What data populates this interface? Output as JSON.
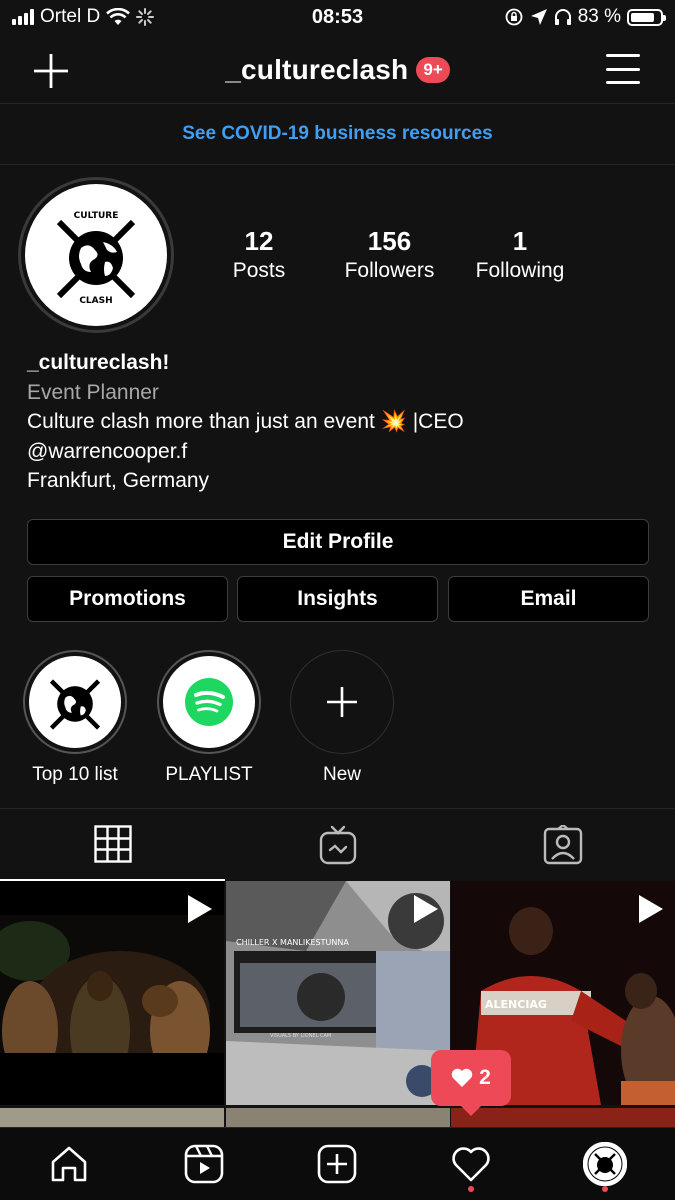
{
  "status": {
    "carrier": "Ortel D",
    "time": "08:53",
    "battery": "83 %"
  },
  "header": {
    "plus_icon": "plus-icon",
    "username": "_cultureclash",
    "badge": "9+",
    "menu_icon": "hamburger-menu-icon"
  },
  "banner": {
    "text": "See COVID-19 business resources"
  },
  "profile": {
    "avatar_text_top": "CULTURE",
    "avatar_text_bottom": "CLASH",
    "stats": [
      {
        "num": "12",
        "label": "Posts"
      },
      {
        "num": "156",
        "label": "Followers"
      },
      {
        "num": "1",
        "label": "Following"
      }
    ],
    "bio": {
      "name": "_cultureclash!",
      "category": "Event Planner",
      "line1": "Culture clash more than just an event",
      "line1_emoji": "💥",
      "line1_tail": " |CEO",
      "line2": "@warrencooper.f",
      "line3": "Frankfurt, Germany"
    }
  },
  "buttons": {
    "edit": "Edit Profile",
    "promotions": "Promotions",
    "insights": "Insights",
    "email": "Email"
  },
  "highlights": [
    {
      "label": "Top 10 list",
      "icon": "culture-clash-logo"
    },
    {
      "label": "PLAYLIST",
      "icon": "spotify-icon"
    },
    {
      "label": "New",
      "icon": "plus-icon"
    }
  ],
  "tabs": [
    {
      "icon": "grid-icon",
      "active": true
    },
    {
      "icon": "igtv-icon",
      "active": false
    },
    {
      "icon": "tagged-person-icon",
      "active": false
    }
  ],
  "posts": [
    {
      "type": "video",
      "colors": [
        "#0e0c08",
        "#3a2a14",
        "#7a5a34"
      ]
    },
    {
      "type": "video",
      "overlay_text_top": "CHILLER X MANLIKESTUNNA",
      "overlay_text_bottom": "VISUALS BY LIONEL CAM",
      "colors": [
        "#8a8a8a",
        "#4a4a4a",
        "#c4c4c4"
      ]
    },
    {
      "type": "video",
      "overlay_text": "ALENCIAG",
      "colors": [
        "#1a0808",
        "#8a1a14",
        "#c42a20"
      ]
    }
  ],
  "activity_popup": {
    "icon": "heart-icon",
    "count": "2"
  },
  "bottom_nav": [
    {
      "icon": "home-icon"
    },
    {
      "icon": "reels-icon"
    },
    {
      "icon": "new-post-icon"
    },
    {
      "icon": "activity-heart-icon"
    },
    {
      "icon": "profile-avatar-icon"
    }
  ],
  "colors": {
    "accent_blue": "#3f9ff4",
    "badge_red": "#ed4956",
    "background": "#121212"
  }
}
